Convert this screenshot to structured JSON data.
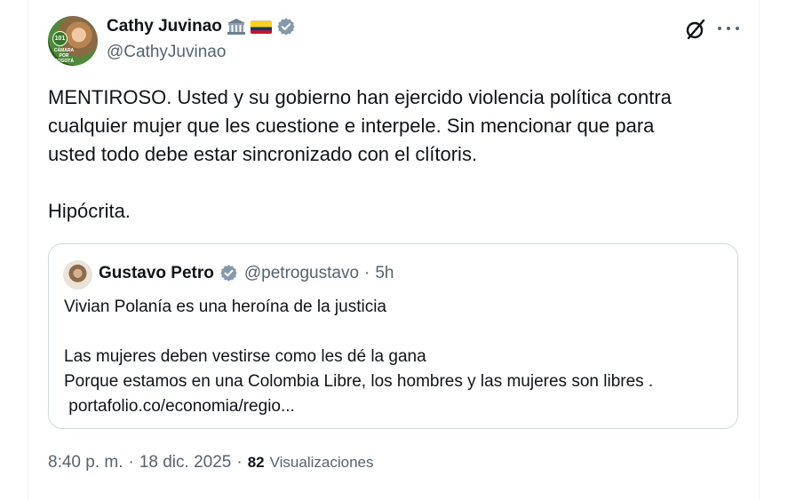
{
  "author": {
    "name": "Cathy Juvinao",
    "handle": "@CathyJuvinao",
    "avatar_badge": "101",
    "avatar_caption": "CÁMARA POR BOGOTÁ"
  },
  "tweet": {
    "paragraphs": [
      "MENTIROSO. Usted y su gobierno han ejercido violencia política contra",
      "cualquier mujer que les cuestione e interpele. Sin mencionar que para",
      "usted todo debe estar sincronizado con el clítoris."
    ],
    "closing": "Hipócrita."
  },
  "quoted_tweet": {
    "name": "Gustavo Petro",
    "handle": "@petrogustavo",
    "separator": "·",
    "time": "5h",
    "line1": "Vivian Polanía es una heroína de la justicia",
    "line2": "Las mujeres deben vestirse como les dé la gana",
    "line3": "Porque estamos en una Colombia Libre, los hombres y las mujeres son libres .",
    "link": " portafolio.co/economia/regio..."
  },
  "footer": {
    "time": "8:40 p. m.",
    "dot1": "·",
    "date": "18 dic. 2025",
    "dot2": "·",
    "views_count": "82",
    "views_label": "Visualizaciones"
  },
  "colors": {
    "verified": "#829aab",
    "secondary_text": "#536471",
    "border": "#cfd9de"
  },
  "icons": [
    "bank-icon",
    "colombia-flag-icon",
    "verified-badge-icon",
    "grok-icon",
    "more-icon"
  ]
}
